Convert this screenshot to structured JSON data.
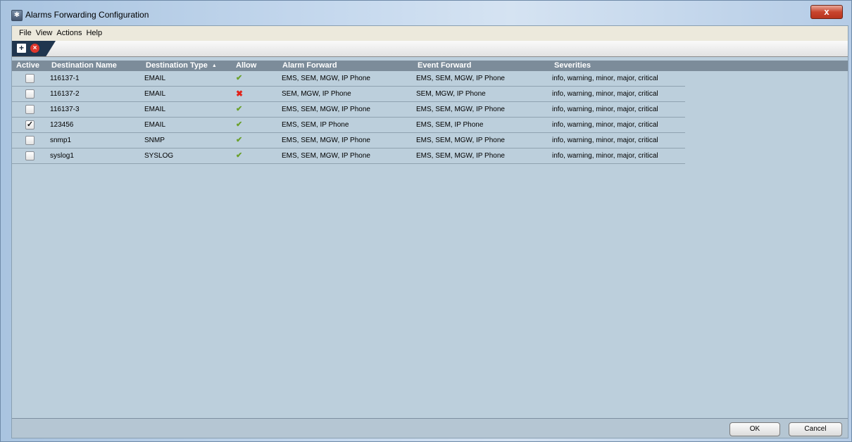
{
  "window": {
    "title": "Alarms Forwarding Configuration",
    "close_label": "x"
  },
  "menu": {
    "file": "File",
    "view": "View",
    "actions": "Actions",
    "help": "Help"
  },
  "toolbar": {
    "add_glyph": "+",
    "delete_glyph": "×"
  },
  "table": {
    "columns": {
      "active": "Active",
      "destination_name": "Destination Name",
      "destination_type": "Destination Type",
      "allow": "Allow",
      "alarm_forward": "Alarm Forward",
      "event_forward": "Event Forward",
      "severities": "Severities"
    },
    "sort_indicator": "▲",
    "rows": [
      {
        "active": "",
        "name": "116137-1",
        "type": "EMAIL",
        "allow": "✔",
        "alarm_forward": "EMS, SEM, MGW, IP Phone",
        "event_forward": "EMS, SEM, MGW, IP Phone",
        "severities": "info, warning, minor, major, critical"
      },
      {
        "active": "",
        "name": "116137-2",
        "type": "EMAIL",
        "allow": "✖",
        "alarm_forward": "SEM, MGW, IP Phone",
        "event_forward": "SEM, MGW, IP Phone",
        "severities": "info, warning, minor, major, critical"
      },
      {
        "active": "",
        "name": "116137-3",
        "type": "EMAIL",
        "allow": "✔",
        "alarm_forward": "EMS, SEM, MGW, IP Phone",
        "event_forward": "EMS, SEM, MGW, IP Phone",
        "severities": "info, warning, minor, major, critical"
      },
      {
        "active": "✓",
        "name": "123456",
        "type": "EMAIL",
        "allow": "✔",
        "alarm_forward": "EMS, SEM, IP Phone",
        "event_forward": "EMS, SEM, IP Phone",
        "severities": "info, warning, minor, major, critical"
      },
      {
        "active": "",
        "name": "snmp1",
        "type": "SNMP",
        "allow": "✔",
        "alarm_forward": "EMS, SEM, MGW, IP Phone",
        "event_forward": "EMS, SEM, MGW, IP Phone",
        "severities": "info, warning, minor, major, critical"
      },
      {
        "active": "",
        "name": "syslog1",
        "type": "SYSLOG",
        "allow": "✔",
        "alarm_forward": "EMS, SEM, MGW, IP Phone",
        "event_forward": "EMS, SEM, MGW, IP Phone",
        "severities": "info, warning, minor, major, critical"
      }
    ]
  },
  "buttons": {
    "ok": "OK",
    "cancel": "Cancel"
  },
  "colors": {
    "allow_yes": "#6aa02a",
    "allow_no": "#e2231a",
    "header_bg": "#7c8c9a",
    "table_bg": "#bccfdc"
  }
}
